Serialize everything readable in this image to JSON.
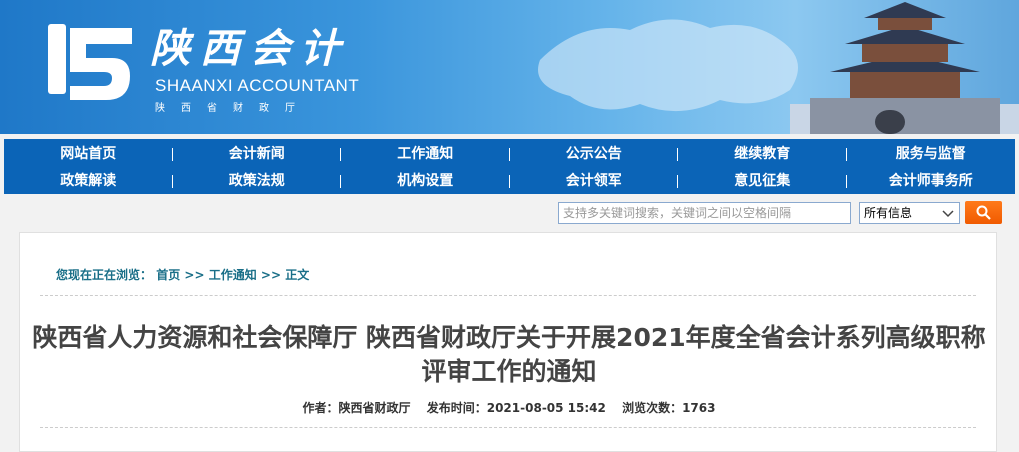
{
  "header": {
    "logo_cn": "陕西会计",
    "logo_en": "SHAANXI ACCOUNTANT",
    "logo_sub": "陕西省财政厅",
    "colors": {
      "banner_start": "#1f78c8",
      "banner_end": "#8cc8f0"
    }
  },
  "nav": {
    "row1": [
      "网站首页",
      "会计新闻",
      "工作通知",
      "公示公告",
      "继续教育",
      "服务与监督"
    ],
    "row2": [
      "政策解读",
      "政策法规",
      "机构设置",
      "会计领军",
      "意见征集",
      "会计师事务所"
    ],
    "color": "#0b64b7"
  },
  "search": {
    "placeholder": "支持多关键词搜索，关键词之间以空格间隔",
    "scope": "所有信息",
    "button_color": "#f05a00"
  },
  "breadcrumb": {
    "prefix": "您现在正在浏览：",
    "items": [
      "首页",
      "工作通知",
      "正文"
    ],
    "separator": ">>"
  },
  "article": {
    "title": "陕西省人力资源和社会保障厅 陕西省财政厅关于开展2021年度全省会计系列高级职称评审工作的通知",
    "author_label": "作者：",
    "author": "陕西省财政厅",
    "published_label": "发布时间：",
    "published": "2021-08-05 15:42",
    "views_label": "浏览次数：",
    "views": "1763"
  }
}
